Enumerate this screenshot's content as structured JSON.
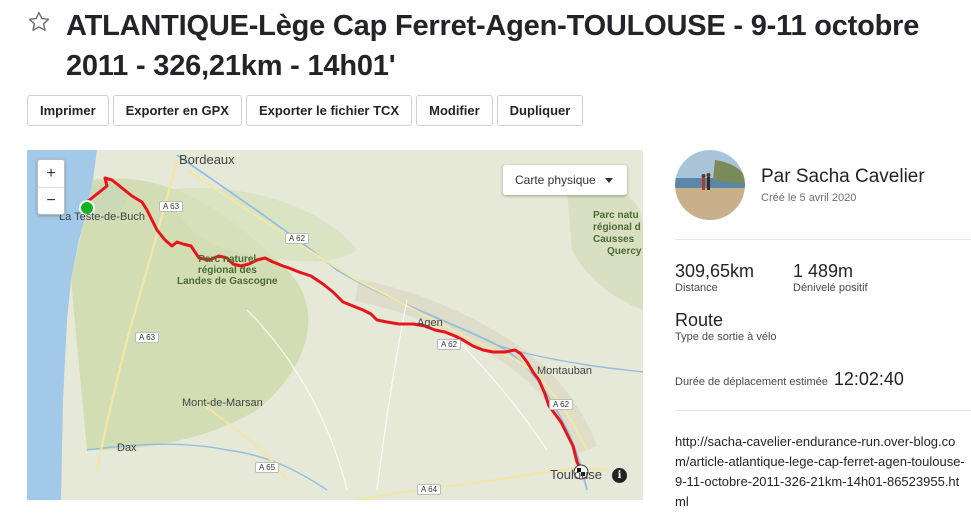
{
  "route": {
    "title": "ATLANTIQUE-Lège Cap Ferret-Agen-TOULOUSE - 9-11 octobre 2011 - 326,21km - 14h01'",
    "star_icon": "star-outline-icon"
  },
  "actions": {
    "print": "Imprimer",
    "export_gpx": "Exporter en GPX",
    "export_tcx": "Exporter le fichier TCX",
    "edit": "Modifier",
    "duplicate": "Dupliquer"
  },
  "map": {
    "zoom_in": "+",
    "zoom_out": "−",
    "map_type": "Carte physique",
    "info_icon": "i",
    "labels": {
      "bordeaux": "Bordeaux",
      "teste": "La Teste-de-Buch",
      "parc_landes_1": "Parc naturel",
      "parc_landes_2": "régional des",
      "parc_landes_3": "Landes de Gascogne",
      "parc_causses_1": "Parc natu",
      "parc_causses_2": "régional d",
      "parc_causses_3": "Causses",
      "parc_causses_4": "Quercy",
      "agen": "Agen",
      "montauban": "Montauban",
      "mont_de_marsan": "Mont-de-Marsan",
      "dax": "Dax",
      "toulouse": "Toulouse",
      "a63_top": "A 63",
      "a62_top": "A 62",
      "a63_left": "A 63",
      "a62_mid": "A 62",
      "a62_right": "A 62",
      "a65": "A 65",
      "a64": "A 64"
    },
    "colors": {
      "route": "#e8141c",
      "start": "#12b31e",
      "water": "#a3c9e8"
    }
  },
  "author": {
    "name": "Par Sacha Cavelier",
    "created": "Créé le 5 avril 2020"
  },
  "stats": {
    "distance_value": "309,65km",
    "distance_label": "Distance",
    "elevation_value": "1 489m",
    "elevation_label": "Dénivelé positif",
    "route_type": "Route",
    "route_sub": "Type de sortie à vélo",
    "duration_label": "Durée de déplacement estimée",
    "duration_value": "12:02:40"
  },
  "description": "http://sacha-cavelier-endurance-run.over-blog.com/article-atlantique-lege-cap-ferret-agen-toulouse-9-11-octobre-2011-326-21km-14h01-86523955.html"
}
